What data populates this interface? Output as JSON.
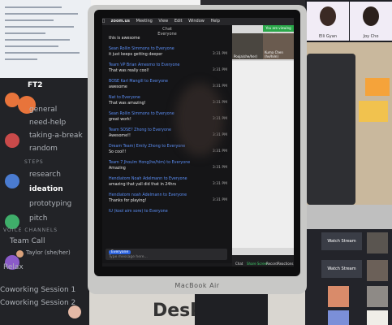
{
  "zoom_gallery": {
    "participants": [
      "Elli Gyan",
      "Joy Cho"
    ]
  },
  "discord": {
    "server_badge": "FT2",
    "channels_top": [
      "general",
      "need-help",
      "taking-a-break",
      "random"
    ],
    "category_steps": "STEPS",
    "channels_steps": [
      "research",
      "ideation",
      "prototyping",
      "pitch"
    ],
    "category_voice": "VOICE CHANNELS",
    "voice": [
      "Team Call",
      "Taylor (she/her)",
      "Relax",
      "Coworking Session 1",
      "Coworking Session 2"
    ]
  },
  "laptop": {
    "menubar": [
      "zoom.us",
      "Meeting",
      "View",
      "Edit",
      "Window",
      "Help"
    ],
    "chat_title": "Chat\nEveryone",
    "messages": [
      {
        "from": "",
        "text": "this is awesome",
        "time": ""
      },
      {
        "from": "Sean Rollin Simmons to Everyone",
        "text": "it just keeps getting deeper",
        "time": "3:31 PM"
      },
      {
        "from": "Team VP Brian Amesmo to Everyone",
        "text": "That was really cool!",
        "time": "3:31 PM"
      },
      {
        "from": "BOSE Karl Mangill to Everyone",
        "text": "awesome",
        "time": "3:31 PM"
      },
      {
        "from": "Nat to Everyone",
        "text": "That was amazing!",
        "time": "3:31 PM"
      },
      {
        "from": "Sean Rollin Simmons to Everyone",
        "text": "great work!",
        "time": "3:31 PM"
      },
      {
        "from": "Team SOSE? Zhong to Everyone",
        "text": "Awesome!!",
        "time": "3:31 PM"
      },
      {
        "from": "Dream Team) Emily Zhong to Everyone",
        "text": "So cool!!",
        "time": "3:31 PM"
      },
      {
        "from": "Team 7 Jhoulm Hong(he/him) to Everyone",
        "text": "Amazing",
        "time": "3:31 PM"
      },
      {
        "from": "Hendiatom Noah Adelmann to Everyone",
        "text": "amazing that yall did that in 24hrs",
        "time": "3:31 PM"
      },
      {
        "from": "Hendiatom noah Adelmann to Everyone",
        "text": "Thanks for playing!",
        "time": "3:31 PM"
      },
      {
        "from": "IU (kool aim sore) to Everyone",
        "text": "",
        "time": ""
      }
    ],
    "to_chip": "Everyone",
    "input_placeholder": "Type message here...",
    "video_names": [
      "Pooja(she/her)",
      "Kuma Chen (he/him)"
    ],
    "recording_label": "You are viewing Emily...",
    "toolbar": [
      "Chat",
      "Share Screen",
      "Record",
      "Reactions"
    ],
    "brand": "MacBook Air"
  },
  "right_grid": {
    "watch_stream": [
      "Watch Stream",
      "Watch Stream"
    ]
  },
  "bottom": {
    "desktop_text": "Deskt"
  }
}
